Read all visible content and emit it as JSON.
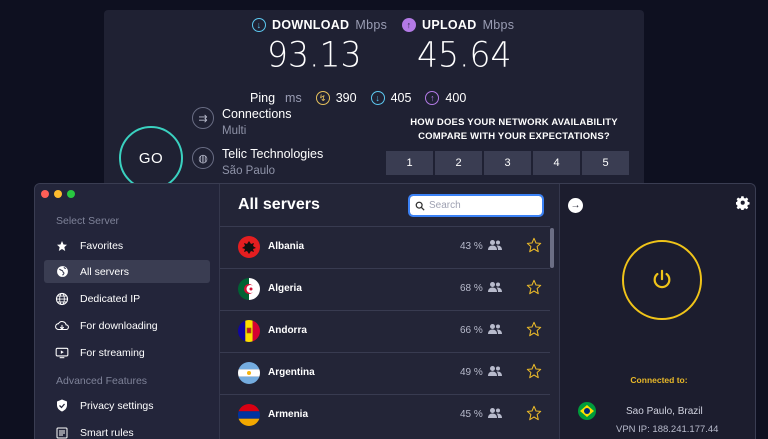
{
  "speedtest": {
    "download": {
      "label": "DOWNLOAD",
      "unit": "Mbps",
      "value": "93.13"
    },
    "upload": {
      "label": "UPLOAD",
      "unit": "Mbps",
      "value": "45.64"
    },
    "ping": {
      "label": "Ping",
      "unit": "ms",
      "idle": "390",
      "download": "405",
      "upload": "400"
    },
    "go_label": "GO",
    "connections": {
      "title": "Connections",
      "value": "Multi"
    },
    "provider": {
      "name": "Telic Technologies",
      "location": "São Paulo"
    },
    "question": "HOW DOES YOUR NETWORK AVAILABILITY COMPARE WITH YOUR EXPECTATIONS?",
    "rating": [
      "1",
      "2",
      "3",
      "4",
      "5"
    ]
  },
  "sidebar": {
    "section_select": "Select Server",
    "items": [
      {
        "label": "Favorites",
        "icon": "star-icon"
      },
      {
        "label": "All servers",
        "icon": "globe-icon",
        "active": true
      },
      {
        "label": "Dedicated IP",
        "icon": "globe-grid-icon"
      },
      {
        "label": "For downloading",
        "icon": "cloud-download-icon"
      },
      {
        "label": "For streaming",
        "icon": "tv-play-icon"
      }
    ],
    "section_advanced": "Advanced Features",
    "advanced_items": [
      {
        "label": "Privacy settings",
        "icon": "shield-icon"
      },
      {
        "label": "Smart rules",
        "icon": "rules-icon"
      }
    ]
  },
  "servers": {
    "title": "All servers",
    "search_placeholder": "Search",
    "rows": [
      {
        "name": "Albania",
        "load": "43 %"
      },
      {
        "name": "Algeria",
        "load": "68 %"
      },
      {
        "name": "Andorra",
        "load": "66 %"
      },
      {
        "name": "Argentina",
        "load": "49 %"
      },
      {
        "name": "Armenia",
        "load": "45 %"
      }
    ]
  },
  "connection": {
    "status_label": "Connected to:",
    "location": "Sao Paulo, Brazil",
    "vpn_ip": "VPN IP: 188.241.177.44"
  },
  "colors": {
    "accent_teal": "#3ad1c0",
    "accent_yellow": "#f0c419",
    "download_blue": "#5cc8f0",
    "upload_purple": "#b37ae6"
  }
}
